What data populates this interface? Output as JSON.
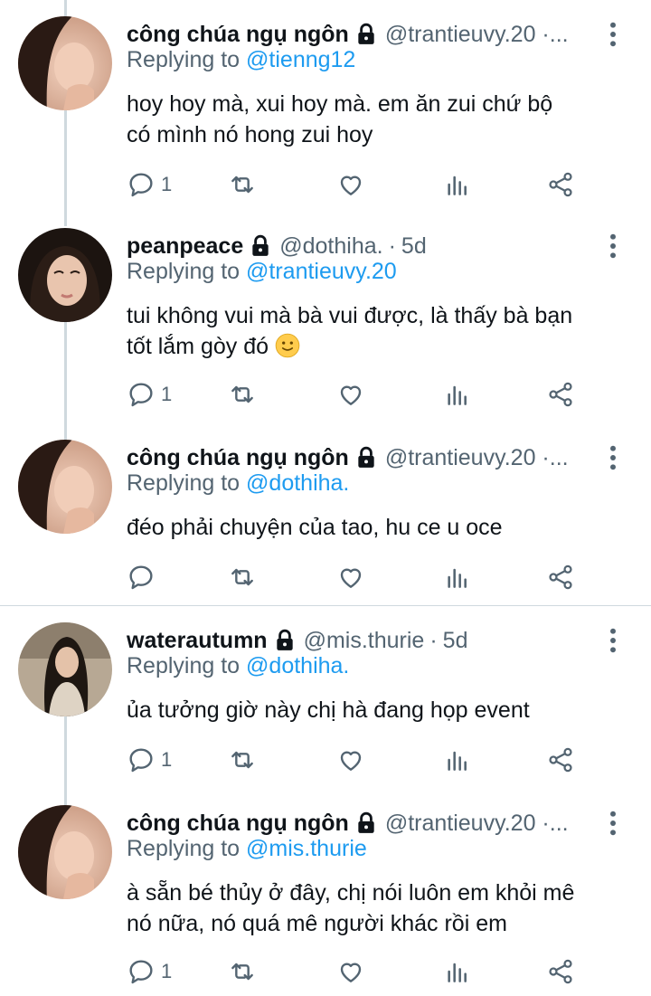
{
  "tweets": [
    {
      "author_name": "công chúa ngụ ngôn",
      "handle": "@trantieuvy.20 ·...",
      "time": "",
      "replying_prefix": "Replying to",
      "replying_to": "@tienng12",
      "text_line1": "hoy hoy mà, xui hoy mà. em ăn zui chứ bộ",
      "text_line2": "có mình nó hong zui hoy",
      "reply_count": "1"
    },
    {
      "author_name": "peanpeace",
      "handle": "@dothiha.",
      "time": "5d",
      "replying_prefix": "Replying to",
      "replying_to": "@trantieuvy.20",
      "text_line1": "tui không vui mà bà vui được, là thấy bà bạn",
      "text_line2": "tốt lắm gòy đó",
      "reply_count": "1"
    },
    {
      "author_name": "công chúa ngụ ngôn",
      "handle": "@trantieuvy.20 ·...",
      "time": "",
      "replying_prefix": "Replying to",
      "replying_to": "@dothiha.",
      "text_line1": "đéo phải chuyện của tao, hu ce u oce",
      "text_line2": "",
      "reply_count": ""
    },
    {
      "author_name": "waterautumn",
      "handle": "@mis.thurie",
      "time": "5d",
      "replying_prefix": "Replying to",
      "replying_to": "@dothiha.",
      "text_line1": "ủa tưởng giờ này chị hà đang họp event",
      "text_line2": "",
      "reply_count": "1"
    },
    {
      "author_name": "công chúa ngụ ngôn",
      "handle": "@trantieuvy.20 ·...",
      "time": "",
      "replying_prefix": "Replying to",
      "replying_to": "@mis.thurie",
      "text_line1": "à sẵn bé thủy ở đây, chị nói luôn em khỏi mê",
      "text_line2": "nó nữa, nó quá mê người khác rồi em",
      "reply_count": "1"
    }
  ],
  "icons": {
    "reply": "reply-icon",
    "retweet": "retweet-icon",
    "like": "heart-icon",
    "views": "views-icon",
    "share": "share-icon",
    "lock": "lock-icon",
    "more": "more-vertical-icon",
    "emoji": "slightly-smiling-face-emoji"
  },
  "colors": {
    "text": "#0f1419",
    "secondary": "#536471",
    "link": "#1d9bf0",
    "divider": "#cfd9de"
  }
}
